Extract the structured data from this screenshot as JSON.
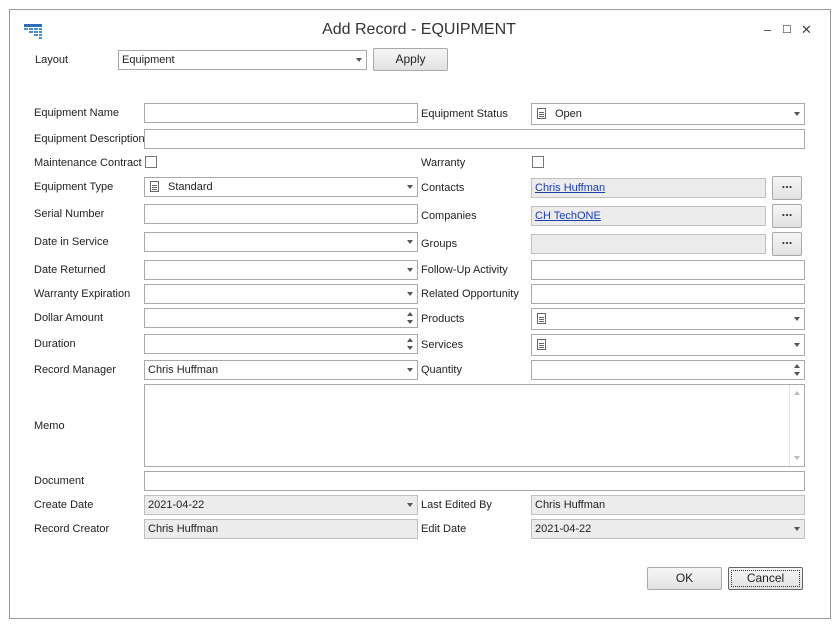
{
  "window": {
    "title": "Add Record - EQUIPMENT",
    "minimize_glyph": "–",
    "maximize_glyph": "☐",
    "close_glyph": "✕"
  },
  "layout": {
    "label": "Layout",
    "value": "Equipment",
    "apply_label": "Apply"
  },
  "left": {
    "equipment_name": {
      "label": "Equipment Name",
      "value": ""
    },
    "equipment_description": {
      "label": "Equipment Description",
      "value": ""
    },
    "maintenance_contract": {
      "label": "Maintenance Contract",
      "checked": false
    },
    "equipment_type": {
      "label": "Equipment Type",
      "value": "Standard"
    },
    "serial_number": {
      "label": "Serial Number",
      "value": ""
    },
    "date_in_service": {
      "label": "Date in Service",
      "value": ""
    },
    "date_returned": {
      "label": "Date Returned",
      "value": ""
    },
    "warranty_expiration": {
      "label": "Warranty Expiration",
      "value": ""
    },
    "dollar_amount": {
      "label": "Dollar Amount",
      "value": ""
    },
    "duration": {
      "label": "Duration",
      "value": ""
    },
    "record_manager": {
      "label": "Record Manager",
      "value": "Chris Huffman"
    },
    "memo": {
      "label": "Memo",
      "value": ""
    },
    "document": {
      "label": "Document",
      "value": ""
    },
    "create_date": {
      "label": "Create Date",
      "value": "2021-04-22"
    },
    "record_creator": {
      "label": "Record Creator",
      "value": "Chris Huffman"
    }
  },
  "right": {
    "equipment_status": {
      "label": "Equipment Status",
      "value": "Open"
    },
    "warranty": {
      "label": "Warranty",
      "checked": false
    },
    "contacts": {
      "label": "Contacts",
      "value": "Chris Huffman",
      "browse": "..."
    },
    "companies": {
      "label": "Companies",
      "value": "CH TechONE",
      "browse": "..."
    },
    "groups": {
      "label": "Groups",
      "value": "",
      "browse": "..."
    },
    "follow_up_activity": {
      "label": "Follow-Up Activity",
      "value": ""
    },
    "related_opportunity": {
      "label": "Related Opportunity",
      "value": ""
    },
    "products": {
      "label": "Products",
      "value": ""
    },
    "services": {
      "label": "Services",
      "value": ""
    },
    "quantity": {
      "label": "Quantity",
      "value": ""
    },
    "last_edited_by": {
      "label": "Last Edited By",
      "value": "Chris Huffman"
    },
    "edit_date": {
      "label": "Edit Date",
      "value": "2021-04-22"
    }
  },
  "buttons": {
    "ok": "OK",
    "cancel": "Cancel"
  },
  "icons": {
    "app": "grid-table-icon",
    "field": "document-icon"
  },
  "colors": {
    "link": "#1a3fb0",
    "readonly_bg": "#ececec",
    "border": "#a9a9a9"
  }
}
